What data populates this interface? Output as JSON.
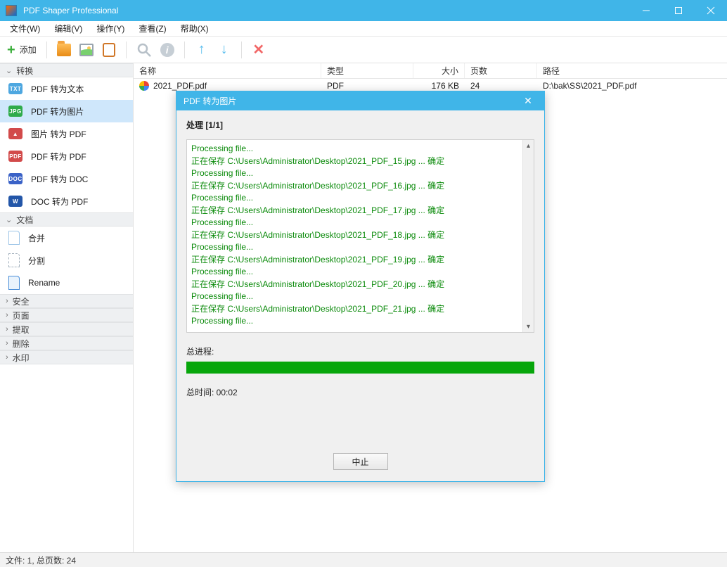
{
  "titlebar": {
    "title": "PDF Shaper Professional"
  },
  "menu": {
    "file": "文件(W)",
    "edit": "编辑(V)",
    "op": "操作(Y)",
    "view": "查看(Z)",
    "help": "帮助(X)"
  },
  "toolbar": {
    "add": "添加"
  },
  "sidebar": {
    "groups": {
      "convert": "转换",
      "document": "文档",
      "security": "安全",
      "pages": "页面",
      "extract": "提取",
      "delete": "删除",
      "watermark": "水印"
    },
    "convert_items": [
      "PDF 转为文本",
      "PDF 转为图片",
      "图片 转为 PDF",
      "PDF 转为 PDF",
      "PDF 转为 DOC",
      "DOC 转为 PDF"
    ],
    "document_items": [
      "合并",
      "分割",
      "Rename"
    ]
  },
  "columns": {
    "name": "名称",
    "type": "类型",
    "size": "大小",
    "pages": "页数",
    "path": "路径"
  },
  "file": {
    "name": "2021_PDF.pdf",
    "type": "PDF",
    "size": "176 KB",
    "pages": "24",
    "path": "D:\\bak\\SS\\2021_PDF.pdf"
  },
  "dialog": {
    "title": "PDF 转为图片",
    "subtitle": "处理 [1/1]",
    "log": [
      "Processing file...",
      "正在保存 C:\\Users\\Administrator\\Desktop\\2021_PDF_15.jpg ... 确定",
      "Processing file...",
      "正在保存 C:\\Users\\Administrator\\Desktop\\2021_PDF_16.jpg ... 确定",
      "Processing file...",
      "正在保存 C:\\Users\\Administrator\\Desktop\\2021_PDF_17.jpg ... 确定",
      "Processing file...",
      "正在保存 C:\\Users\\Administrator\\Desktop\\2021_PDF_18.jpg ... 确定",
      "Processing file...",
      "正在保存 C:\\Users\\Administrator\\Desktop\\2021_PDF_19.jpg ... 确定",
      "Processing file...",
      "正在保存 C:\\Users\\Administrator\\Desktop\\2021_PDF_20.jpg ... 确定",
      "Processing file...",
      "正在保存 C:\\Users\\Administrator\\Desktop\\2021_PDF_21.jpg ... 确定",
      "Processing file..."
    ],
    "progress_label": "总进程:",
    "total_time": "总时间: 00:02",
    "stop": "中止"
  },
  "status": "文件: 1, 总页数: 24"
}
